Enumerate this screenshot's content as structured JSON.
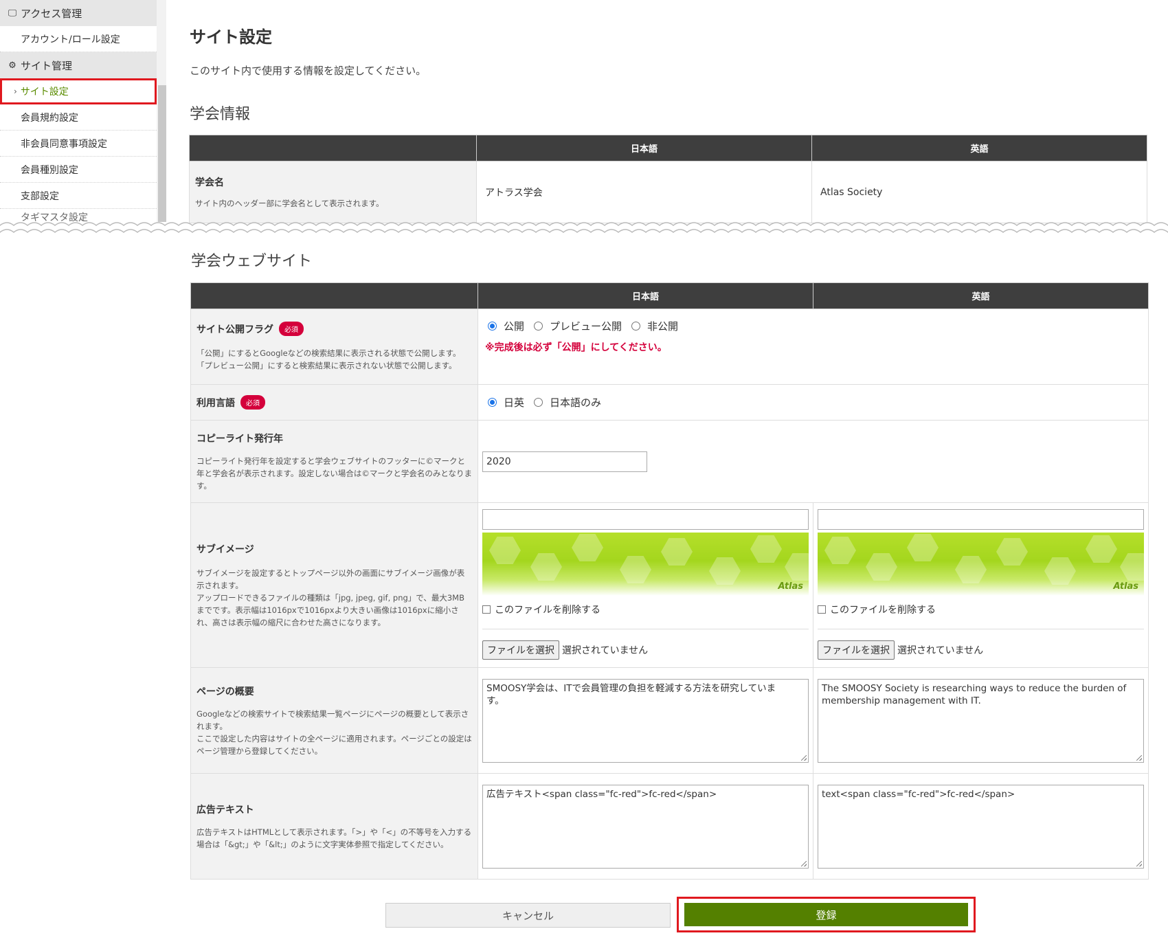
{
  "sidebar": {
    "sections": [
      {
        "icon": "monitor-icon",
        "label": "アクセス管理",
        "items": [
          "アカウント/ロール設定"
        ]
      },
      {
        "icon": "gear-icon",
        "label": "サイト管理",
        "items": [
          "サイト設定",
          "会員規約設定",
          "非会員同意事項設定",
          "会員種別設定",
          "支部設定",
          "タギマスタ設定"
        ]
      }
    ],
    "active_item": "サイト設定"
  },
  "page": {
    "title": "サイト設定",
    "description": "このサイト内で使用する情報を設定してください。"
  },
  "society_info": {
    "title": "学会情報",
    "col_ja": "日本語",
    "col_en": "英語",
    "name_label": "学会名",
    "name_desc": "サイト内のヘッダー部に学会名として表示されます。",
    "name_ja": "アトラス学会",
    "name_en": "Atlas Society"
  },
  "website": {
    "title": "学会ウェブサイト",
    "col_ja": "日本語",
    "col_en": "英語",
    "required_badge": "必須",
    "publish": {
      "label": "サイト公開フラグ",
      "desc": "「公開」にするとGoogleなどの検索結果に表示される状態で公開します。\n「プレビュー公開」にすると検索結果に表示されない状態で公開します。",
      "options": [
        "公開",
        "プレビュー公開",
        "非公開"
      ],
      "selected": "公開",
      "warning": "※完成後は必ず「公開」にしてください。"
    },
    "language": {
      "label": "利用言語",
      "options": [
        "日英",
        "日本語のみ"
      ],
      "selected": "日英"
    },
    "copyright": {
      "label": "コピーライト発行年",
      "desc": "コピーライト発行年を設定すると学会ウェブサイトのフッターに©マークと年と学会名が表示されます。設定しない場合は©マークと学会名のみとなります。",
      "value": "2020"
    },
    "sub_image": {
      "label": "サブイメージ",
      "desc": "サブイメージを設定するとトップページ以外の画面にサブイメージ画像が表示されます。\nアップロードできるファイルの種類は「jpg, jpeg, gif, png」で、最大3MBまでです。表示幅は1016pxで1016pxより大きい画像は1016pxに縮小され、高さは表示幅の縮尺に合わせた高さになります。",
      "logo_text": "Atlas",
      "delete_label": "このファイルを削除する",
      "file_button": "ファイルを選択",
      "no_file": "選択されていません"
    },
    "page_summary": {
      "label": "ページの概要",
      "desc": "Googleなどの検索サイトで検索結果一覧ページにページの概要として表示されます。\nここで設定した内容はサイトの全ページに適用されます。ページごとの設定はページ管理から登録してください。",
      "ja": "SMOOSY学会は、ITで会員管理の負担を軽減する方法を研究していま\nす。",
      "en": "The SMOOSY Society is researching ways to reduce the burden of\nmembership management with IT."
    },
    "ad_text": {
      "label": "広告テキスト",
      "desc": "広告テキストはHTMLとして表示されます。「>」や「<」の不等号を入力する場合は「&gt;」や「&lt;」のように文字実体参照で指定してください。",
      "ja": "広告テキスト<span class=\"fc-red\">fc-red</span>",
      "en": "text<span class=\"fc-red\">fc-red</span>"
    }
  },
  "actions": {
    "cancel": "キャンセル",
    "submit": "登録"
  }
}
